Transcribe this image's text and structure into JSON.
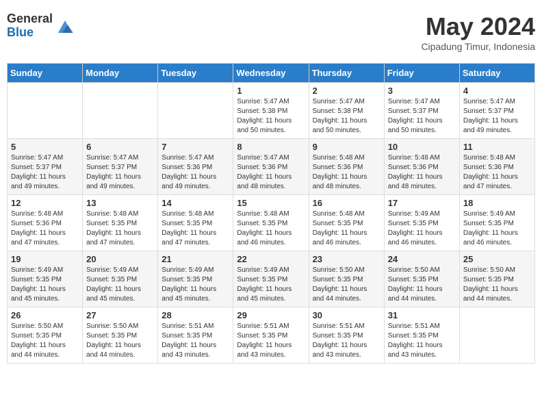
{
  "header": {
    "logo_general": "General",
    "logo_blue": "Blue",
    "month_title": "May 2024",
    "subtitle": "Cipadung Timur, Indonesia"
  },
  "weekdays": [
    "Sunday",
    "Monday",
    "Tuesday",
    "Wednesday",
    "Thursday",
    "Friday",
    "Saturday"
  ],
  "weeks": [
    [
      {
        "day": "",
        "info": ""
      },
      {
        "day": "",
        "info": ""
      },
      {
        "day": "",
        "info": ""
      },
      {
        "day": "1",
        "info": "Sunrise: 5:47 AM\nSunset: 5:38 PM\nDaylight: 11 hours\nand 50 minutes."
      },
      {
        "day": "2",
        "info": "Sunrise: 5:47 AM\nSunset: 5:38 PM\nDaylight: 11 hours\nand 50 minutes."
      },
      {
        "day": "3",
        "info": "Sunrise: 5:47 AM\nSunset: 5:37 PM\nDaylight: 11 hours\nand 50 minutes."
      },
      {
        "day": "4",
        "info": "Sunrise: 5:47 AM\nSunset: 5:37 PM\nDaylight: 11 hours\nand 49 minutes."
      }
    ],
    [
      {
        "day": "5",
        "info": "Sunrise: 5:47 AM\nSunset: 5:37 PM\nDaylight: 11 hours\nand 49 minutes."
      },
      {
        "day": "6",
        "info": "Sunrise: 5:47 AM\nSunset: 5:37 PM\nDaylight: 11 hours\nand 49 minutes."
      },
      {
        "day": "7",
        "info": "Sunrise: 5:47 AM\nSunset: 5:36 PM\nDaylight: 11 hours\nand 49 minutes."
      },
      {
        "day": "8",
        "info": "Sunrise: 5:47 AM\nSunset: 5:36 PM\nDaylight: 11 hours\nand 48 minutes."
      },
      {
        "day": "9",
        "info": "Sunrise: 5:48 AM\nSunset: 5:36 PM\nDaylight: 11 hours\nand 48 minutes."
      },
      {
        "day": "10",
        "info": "Sunrise: 5:48 AM\nSunset: 5:36 PM\nDaylight: 11 hours\nand 48 minutes."
      },
      {
        "day": "11",
        "info": "Sunrise: 5:48 AM\nSunset: 5:36 PM\nDaylight: 11 hours\nand 47 minutes."
      }
    ],
    [
      {
        "day": "12",
        "info": "Sunrise: 5:48 AM\nSunset: 5:36 PM\nDaylight: 11 hours\nand 47 minutes."
      },
      {
        "day": "13",
        "info": "Sunrise: 5:48 AM\nSunset: 5:35 PM\nDaylight: 11 hours\nand 47 minutes."
      },
      {
        "day": "14",
        "info": "Sunrise: 5:48 AM\nSunset: 5:35 PM\nDaylight: 11 hours\nand 47 minutes."
      },
      {
        "day": "15",
        "info": "Sunrise: 5:48 AM\nSunset: 5:35 PM\nDaylight: 11 hours\nand 46 minutes."
      },
      {
        "day": "16",
        "info": "Sunrise: 5:48 AM\nSunset: 5:35 PM\nDaylight: 11 hours\nand 46 minutes."
      },
      {
        "day": "17",
        "info": "Sunrise: 5:49 AM\nSunset: 5:35 PM\nDaylight: 11 hours\nand 46 minutes."
      },
      {
        "day": "18",
        "info": "Sunrise: 5:49 AM\nSunset: 5:35 PM\nDaylight: 11 hours\nand 46 minutes."
      }
    ],
    [
      {
        "day": "19",
        "info": "Sunrise: 5:49 AM\nSunset: 5:35 PM\nDaylight: 11 hours\nand 45 minutes."
      },
      {
        "day": "20",
        "info": "Sunrise: 5:49 AM\nSunset: 5:35 PM\nDaylight: 11 hours\nand 45 minutes."
      },
      {
        "day": "21",
        "info": "Sunrise: 5:49 AM\nSunset: 5:35 PM\nDaylight: 11 hours\nand 45 minutes."
      },
      {
        "day": "22",
        "info": "Sunrise: 5:49 AM\nSunset: 5:35 PM\nDaylight: 11 hours\nand 45 minutes."
      },
      {
        "day": "23",
        "info": "Sunrise: 5:50 AM\nSunset: 5:35 PM\nDaylight: 11 hours\nand 44 minutes."
      },
      {
        "day": "24",
        "info": "Sunrise: 5:50 AM\nSunset: 5:35 PM\nDaylight: 11 hours\nand 44 minutes."
      },
      {
        "day": "25",
        "info": "Sunrise: 5:50 AM\nSunset: 5:35 PM\nDaylight: 11 hours\nand 44 minutes."
      }
    ],
    [
      {
        "day": "26",
        "info": "Sunrise: 5:50 AM\nSunset: 5:35 PM\nDaylight: 11 hours\nand 44 minutes."
      },
      {
        "day": "27",
        "info": "Sunrise: 5:50 AM\nSunset: 5:35 PM\nDaylight: 11 hours\nand 44 minutes."
      },
      {
        "day": "28",
        "info": "Sunrise: 5:51 AM\nSunset: 5:35 PM\nDaylight: 11 hours\nand 43 minutes."
      },
      {
        "day": "29",
        "info": "Sunrise: 5:51 AM\nSunset: 5:35 PM\nDaylight: 11 hours\nand 43 minutes."
      },
      {
        "day": "30",
        "info": "Sunrise: 5:51 AM\nSunset: 5:35 PM\nDaylight: 11 hours\nand 43 minutes."
      },
      {
        "day": "31",
        "info": "Sunrise: 5:51 AM\nSunset: 5:35 PM\nDaylight: 11 hours\nand 43 minutes."
      },
      {
        "day": "",
        "info": ""
      }
    ]
  ]
}
